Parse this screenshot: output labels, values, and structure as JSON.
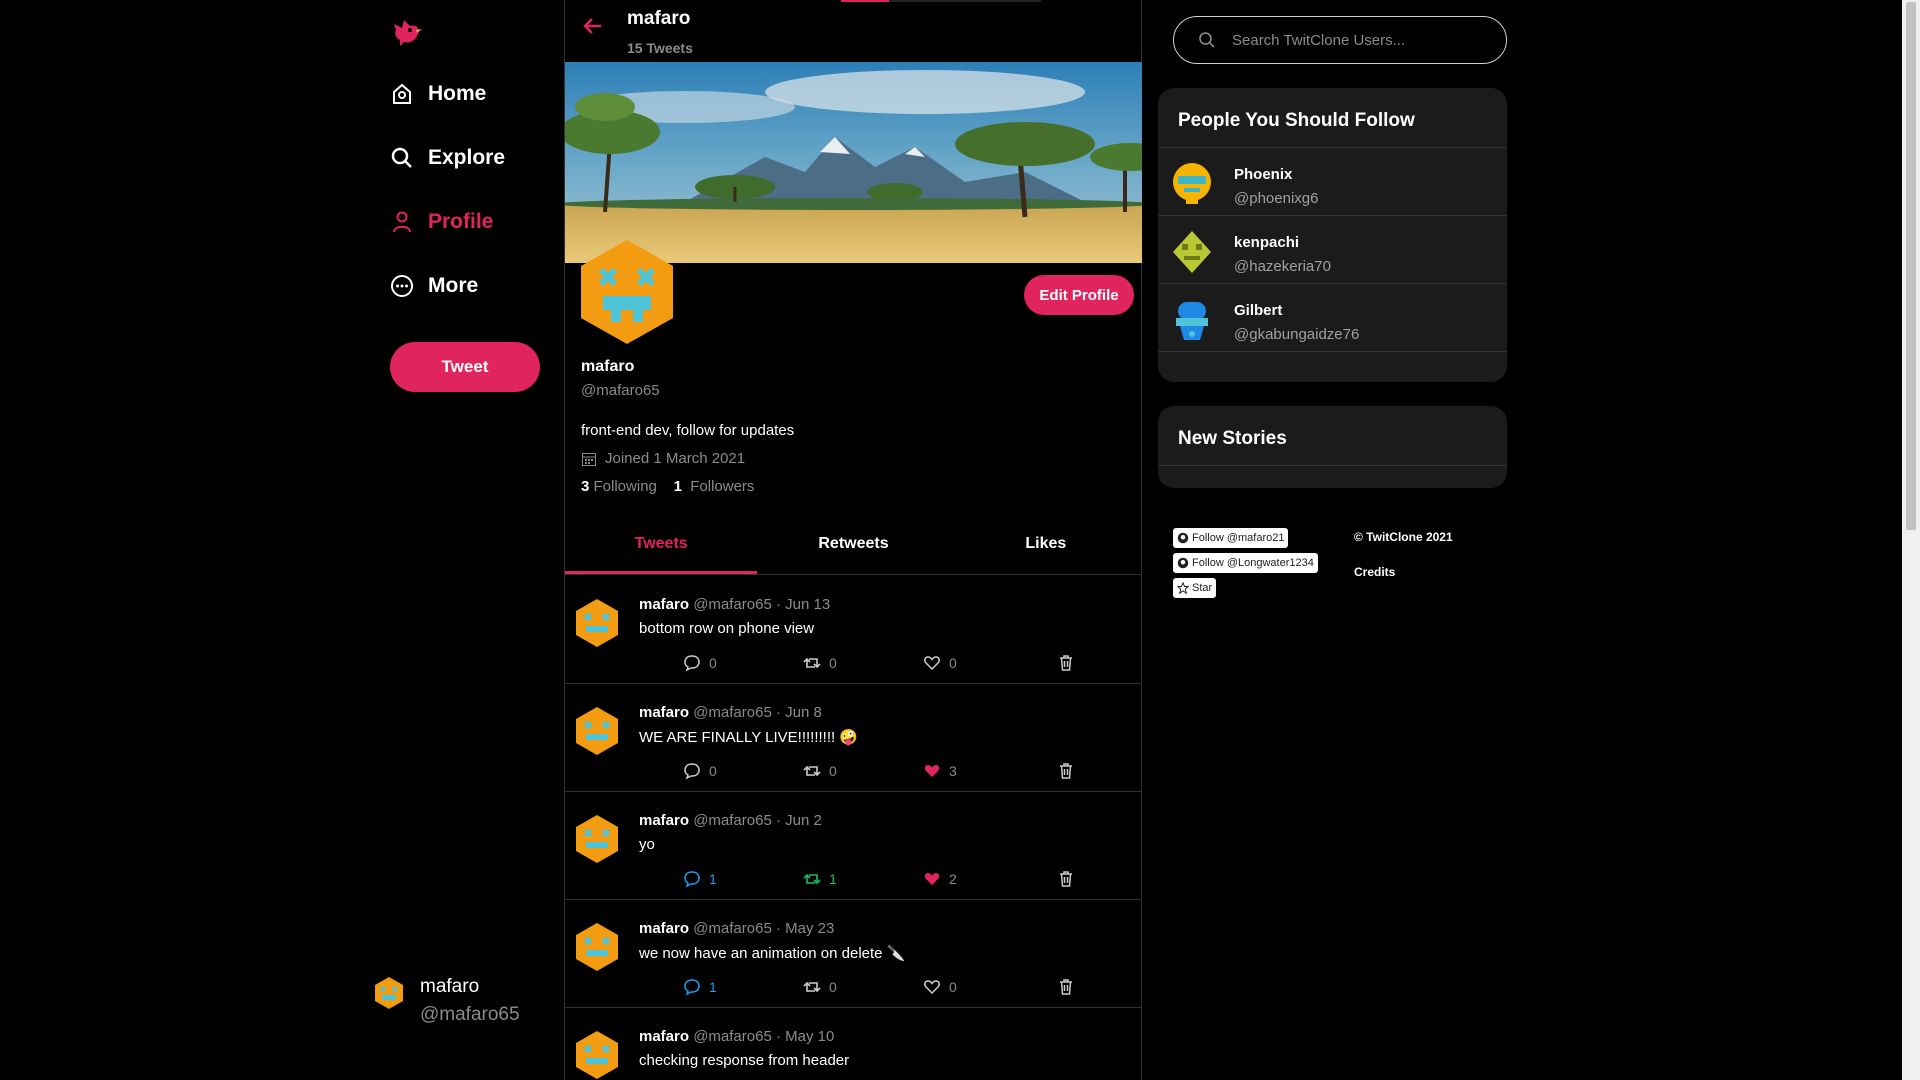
{
  "nav": {
    "items": [
      {
        "label": "Home",
        "icon": "home-icon"
      },
      {
        "label": "Explore",
        "icon": "search-icon"
      },
      {
        "label": "Profile",
        "icon": "user-icon"
      },
      {
        "label": "More",
        "icon": "more-icon"
      }
    ],
    "tweet_label": "Tweet",
    "user": {
      "name": "mafaro",
      "handle": "@mafaro65"
    },
    "accent": "#e0245e"
  },
  "header": {
    "name": "mafaro",
    "count": "15 Tweets"
  },
  "profile": {
    "name": "mafaro",
    "handle": "@mafaro65",
    "bio": "front-end dev, follow for updates",
    "joined": "Joined 1 March 2021",
    "following_count": "3",
    "following_label": "Following",
    "followers_count": "1",
    "followers_label": "Followers",
    "edit_label": "Edit Profile"
  },
  "tabs": [
    "Tweets",
    "Retweets",
    "Likes"
  ],
  "tweets": [
    {
      "name": "mafaro",
      "handle": "@mafaro65",
      "date": "Jun 13",
      "text": "bottom row on phone view",
      "replies": "0",
      "retweets": "0",
      "likes": "0"
    },
    {
      "name": "mafaro",
      "handle": "@mafaro65",
      "date": "Jun 8",
      "text": "WE ARE FINALLY LIVE!!!!!!!!! 🤪",
      "replies": "0",
      "retweets": "0",
      "likes": "3"
    },
    {
      "name": "mafaro",
      "handle": "@mafaro65",
      "date": "Jun 2",
      "text": "yo",
      "replies": "1",
      "retweets": "1",
      "likes": "2"
    },
    {
      "name": "mafaro",
      "handle": "@mafaro65",
      "date": "May 23",
      "text": "we now have an animation on delete 🔪",
      "replies": "1",
      "retweets": "0",
      "likes": "0"
    },
    {
      "name": "mafaro",
      "handle": "@mafaro65",
      "date": "May 10",
      "text": "checking response from header",
      "replies": "",
      "retweets": "",
      "likes": ""
    }
  ],
  "search": {
    "placeholder": "Search TwitClone Users..."
  },
  "follow_card": {
    "title": "People You Should Follow",
    "people": [
      {
        "name": "Phoenix",
        "handle": "@phoenixg6"
      },
      {
        "name": "kenpachi",
        "handle": "@hazekeria70"
      },
      {
        "name": "Gilbert",
        "handle": "@gkabungaidze76"
      }
    ]
  },
  "stories": {
    "title": "New Stories"
  },
  "footer": {
    "follow1": "Follow @mafaro21",
    "follow2": "Follow @Longwater1234",
    "star": "Star",
    "copyright": "© TwitClone 2021",
    "credits": "Credits"
  }
}
